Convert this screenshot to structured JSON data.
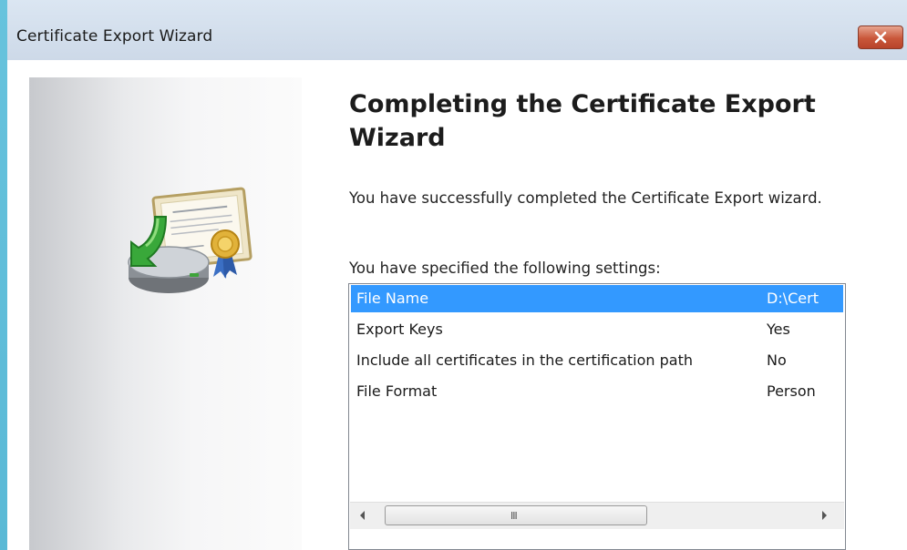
{
  "window": {
    "title": "Certificate Export Wizard"
  },
  "content": {
    "heading": "Completing the Certificate Export Wizard",
    "success_message": "You have successfully completed the Certificate Export wizard.",
    "settings_label": "You have specified the following settings:"
  },
  "settings": {
    "rows": [
      {
        "name": "File Name",
        "value": "D:\\Cert",
        "selected": true
      },
      {
        "name": "Export Keys",
        "value": "Yes",
        "selected": false
      },
      {
        "name": "Include all certificates in the certification path",
        "value": "No",
        "selected": false
      },
      {
        "name": "File Format",
        "value": "Person",
        "selected": false
      }
    ],
    "scrollbar_grip": "III"
  },
  "icons": {
    "close": "close-icon",
    "certificate": "certificate-export-icon",
    "scroll_left": "scroll-left-arrow-icon",
    "scroll_right": "scroll-right-arrow-icon"
  },
  "colors": {
    "selection": "#3399ff",
    "close_button": "#c9573a",
    "title_bar": "#d4e0ed"
  }
}
